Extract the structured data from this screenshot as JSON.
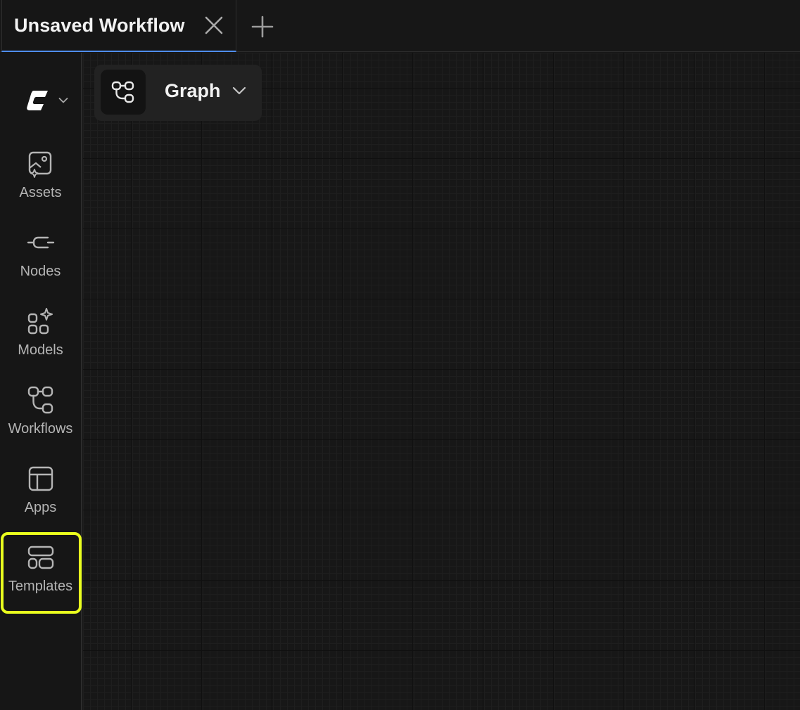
{
  "tabs": [
    {
      "title": "Unsaved Workflow",
      "active": true
    }
  ],
  "icons": {
    "close": "close-icon",
    "new_tab": "plus-icon",
    "logo": "app-logo-icon",
    "logo_menu": "chevron-down-icon",
    "view": "workflow-icon",
    "view_menu": "chevron-down-icon"
  },
  "sidebar": {
    "items": [
      {
        "label": "Assets",
        "icon": "image-sparkle-icon"
      },
      {
        "label": "Nodes",
        "icon": "node-connector-icon"
      },
      {
        "label": "Models",
        "icon": "grid-sparkle-icon"
      },
      {
        "label": "Workflows",
        "icon": "workflow-icon"
      },
      {
        "label": "Apps",
        "icon": "layout-icon"
      },
      {
        "label": "Templates",
        "icon": "templates-icon",
        "highlighted": true
      }
    ]
  },
  "canvas": {
    "view_selector": {
      "label": "Graph"
    }
  },
  "colors": {
    "accent_tab_underline": "#4f8df0",
    "highlight_outline": "#e9ff1e",
    "background": "#161616"
  }
}
